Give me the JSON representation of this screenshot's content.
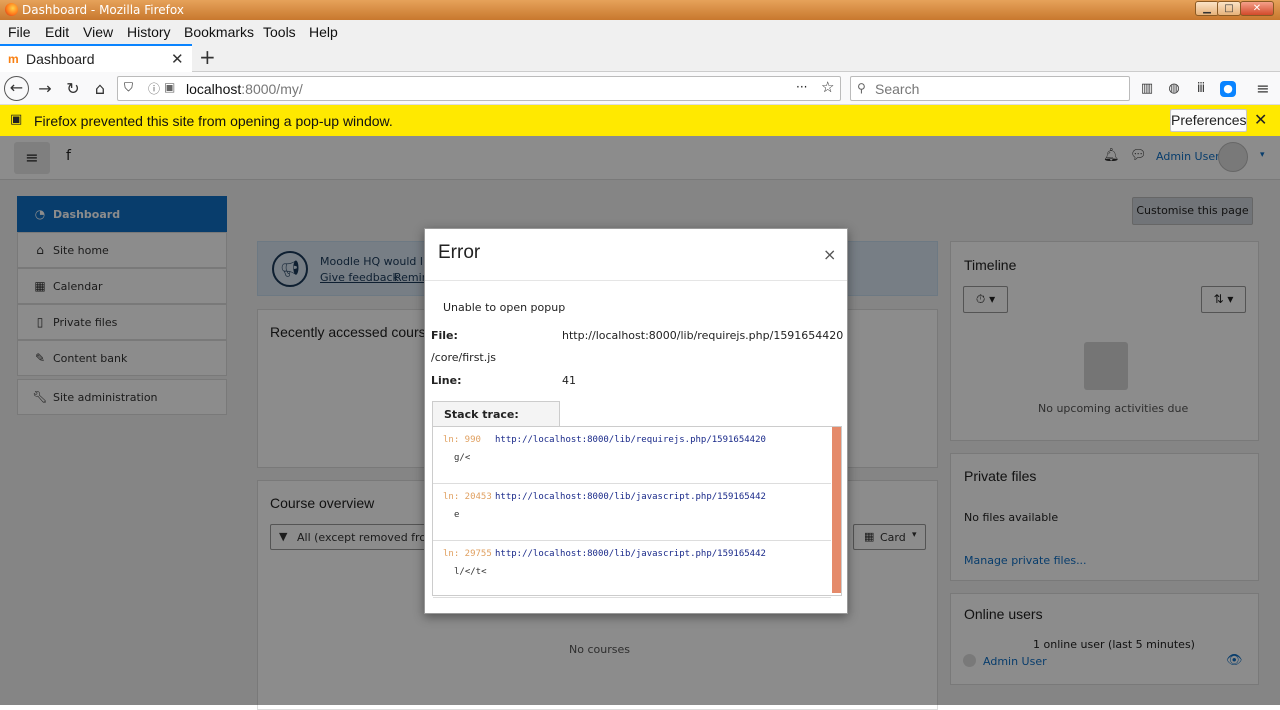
{
  "window": {
    "title": "Dashboard - Mozilla Firefox"
  },
  "menubar": [
    "File",
    "Edit",
    "View",
    "History",
    "Bookmarks",
    "Tools",
    "Help"
  ],
  "tab": {
    "label": "Dashboard",
    "favicon": "m"
  },
  "nav": {
    "url_host": "localhost",
    "url_rest": ":8000/my/",
    "search_placeholder": "Search",
    "more": "···"
  },
  "notification": {
    "message": "Firefox prevented this site from opening a pop-up window.",
    "button": "Preferences"
  },
  "page": {
    "site_short": "f",
    "user": "Admin User",
    "customise": "Customise this page",
    "drawer": [
      {
        "label": "Dashboard",
        "icon": "dashboard-icon"
      },
      {
        "label": "Site home",
        "icon": "home-icon"
      },
      {
        "label": "Calendar",
        "icon": "calendar-icon"
      },
      {
        "label": "Private files",
        "icon": "file-icon"
      },
      {
        "label": "Content bank",
        "icon": "brush-icon"
      },
      {
        "label": "Site administration",
        "icon": "wrench-icon"
      }
    ],
    "feedback": {
      "text": "Moodle HQ would lik",
      "link1": "Give feedback",
      "link2": "Remin"
    },
    "recent": {
      "title": "Recently accessed course"
    },
    "overview": {
      "title": "Course overview",
      "filter": "All (except removed from v",
      "card": "Card",
      "empty": "No courses"
    },
    "timeline": {
      "title": "Timeline",
      "empty": "No upcoming activities due"
    },
    "private_files": {
      "title": "Private files",
      "empty": "No files available",
      "link": "Manage private files..."
    },
    "online": {
      "title": "Online users",
      "count": "1 online user (last 5 minutes)",
      "user": "Admin User"
    }
  },
  "modal": {
    "title": "Error",
    "close": "×",
    "message": "Unable to open popup",
    "file_label": "File:",
    "file_value": "http://localhost:8000/lib/requirejs.php/1591654420",
    "file_value_cont": "/core/first.js",
    "line_label": "Line:",
    "line_value": "41",
    "stack_tab": "Stack trace:",
    "stack": [
      {
        "ln": "ln: 990",
        "url": "http://localhost:8000/lib/requirejs.php/1591654420",
        "fn": "g/<"
      },
      {
        "ln": "ln: 20453",
        "url": "http://localhost:8000/lib/javascript.php/159165442",
        "fn": "e"
      },
      {
        "ln": "ln: 29755",
        "url": "http://localhost:8000/lib/javascript.php/159165442",
        "fn": "l/</t<"
      }
    ]
  },
  "colors": {
    "accent": "#0f6fc5",
    "notification": "#ffe900",
    "link": "#0f6fc5"
  }
}
